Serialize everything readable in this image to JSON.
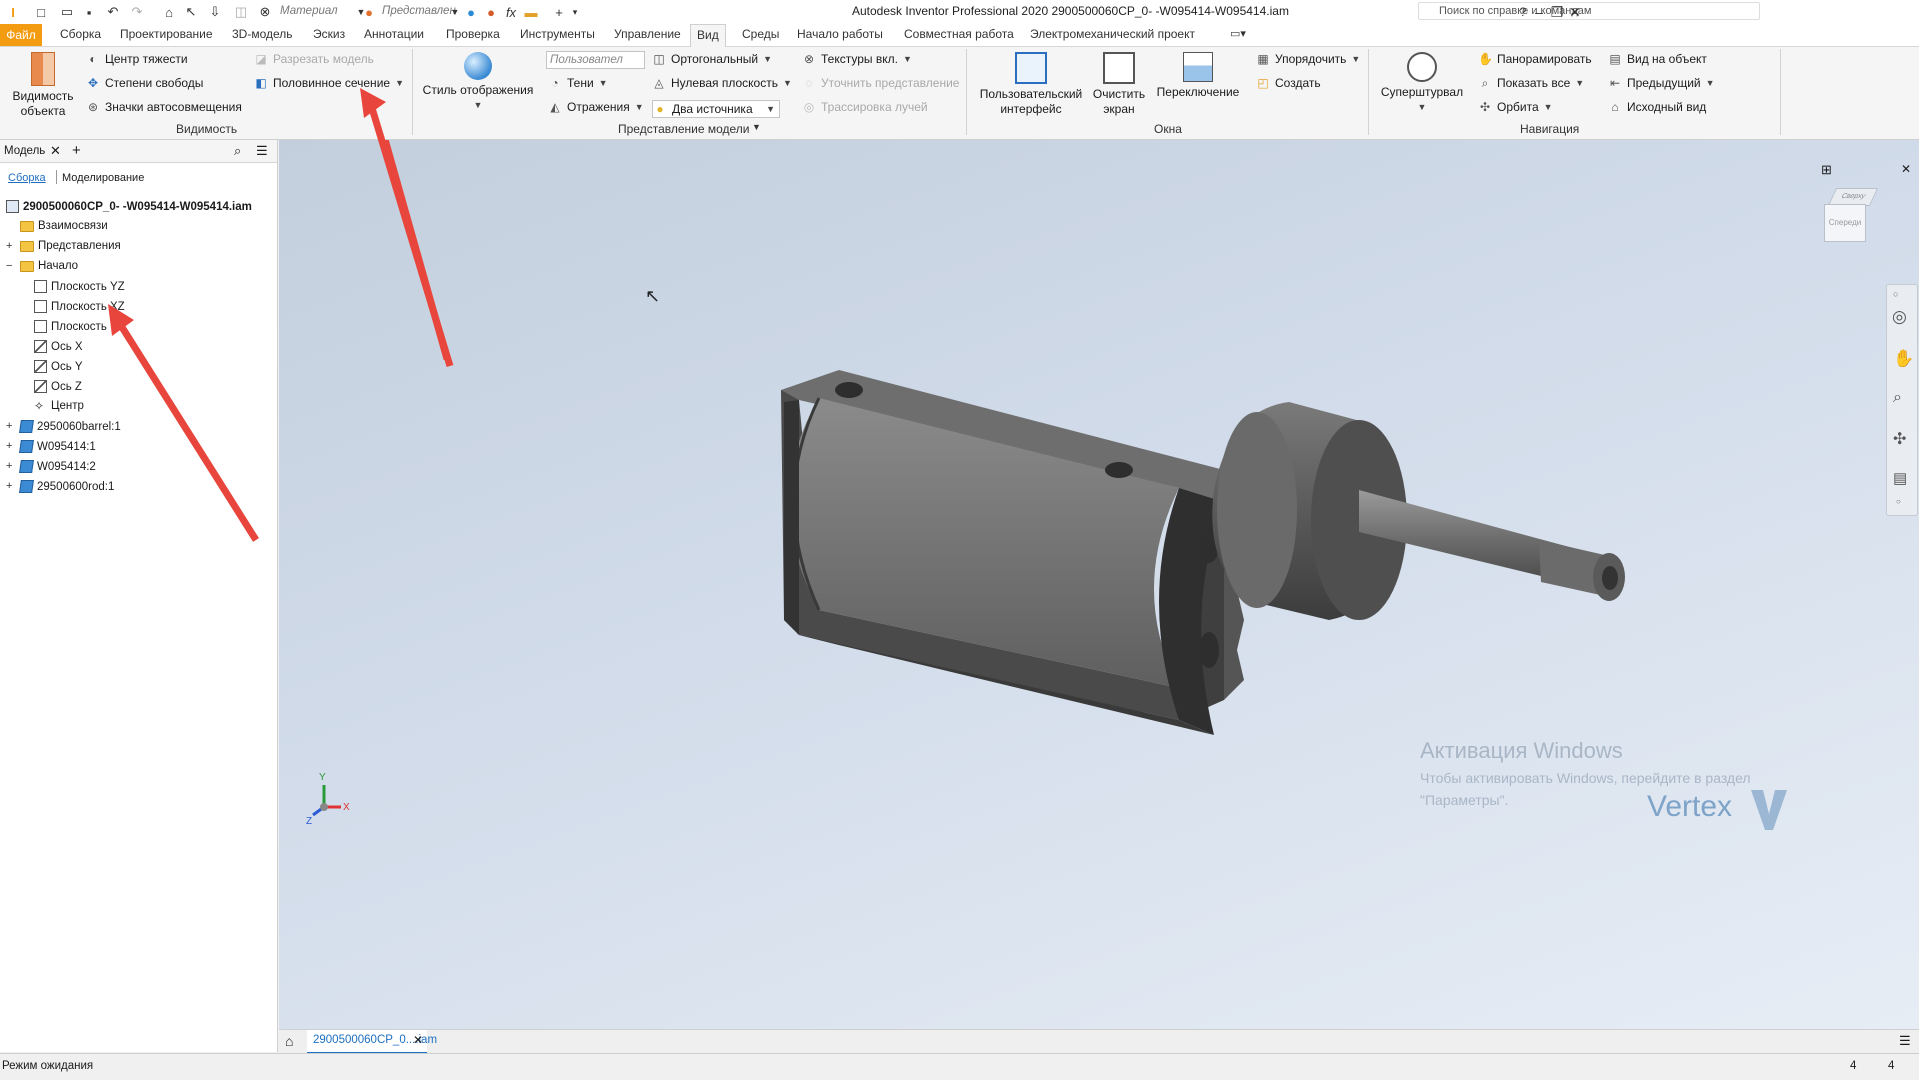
{
  "title": "Autodesk Inventor Professional 2020   2900500060CP_0- -W095414-W095414.iam",
  "quick_access": {
    "material_select": "Материал",
    "appearance_select": "Представлен"
  },
  "search": {
    "placeholder": "Поиск по справке и командам",
    "login": "Вход в службы"
  },
  "tabs": [
    "Сборка",
    "Проектирование",
    "3D-модель",
    "Эскиз",
    "Аннотации",
    "Проверка",
    "Инструменты",
    "Управление",
    "Вид",
    "Среды",
    "Начало работы",
    "Совместная работа",
    "Электромеханический проект"
  ],
  "file_tab": "Файл",
  "active_tab": "Вид",
  "ribbon": {
    "visibility": {
      "big": "Видимость\nобъекта",
      "items": [
        "Центр тяжести",
        "Степени свободы",
        "Значки автосовмещения"
      ],
      "cut_model": "Разрезать модель",
      "half_section": "Половинное сечение",
      "label": "Видимость"
    },
    "appearance": {
      "style_big": "Стиль отображения",
      "user_select": "Пользовател",
      "shadows": "Тени",
      "reflections": "Отражения",
      "ortho": "Ортогональный",
      "ground_plane": "Нулевая плоскость",
      "two_lights": "Два источника",
      "textures": "Текстуры вкл.",
      "refine": "Уточнить представление",
      "raytrace": "Трассировка лучей",
      "label": "Представление модели"
    },
    "windows": {
      "user_interface": "Пользовательский\nинтерфейс",
      "clean_screen": "Очистить\nэкран",
      "switch": "Переключение",
      "arrange": "Упорядочить",
      "create": "Создать",
      "label": "Окна"
    },
    "navigation": {
      "steering": "Суперштурвал",
      "pan": "Панорамировать",
      "zoom_all": "Показать все",
      "orbit": "Орбита",
      "look_at": "Вид на объект",
      "previous": "Предыдущий",
      "home": "Исходный вид",
      "label": "Навигация"
    }
  },
  "panel": {
    "tab_label": "Модель",
    "subtab_assembly": "Сборка",
    "subtab_modeling": "Моделирование",
    "root": "2900500060CP_0- -W095414-W095414.iam",
    "items": [
      {
        "label": "Взаимосвязи",
        "icon": "folder",
        "level": 1,
        "expand": ""
      },
      {
        "label": "Представления",
        "icon": "folder",
        "level": 1,
        "expand": "+"
      },
      {
        "label": "Начало",
        "icon": "folder",
        "level": 1,
        "expand": "−"
      },
      {
        "label": "Плоскость YZ",
        "icon": "plane",
        "level": 2,
        "expand": ""
      },
      {
        "label": "Плоскость XZ",
        "icon": "plane",
        "level": 2,
        "expand": ""
      },
      {
        "label": "Плоскость",
        "icon": "plane",
        "level": 2,
        "expand": ""
      },
      {
        "label": "Ось X",
        "icon": "axis",
        "level": 2,
        "expand": ""
      },
      {
        "label": "Ось Y",
        "icon": "axis",
        "level": 2,
        "expand": ""
      },
      {
        "label": "Ось Z",
        "icon": "axis",
        "level": 2,
        "expand": ""
      },
      {
        "label": "Центр",
        "icon": "point",
        "level": 2,
        "expand": ""
      },
      {
        "label": "2950060barrel:1",
        "icon": "part",
        "level": 1,
        "expand": "+"
      },
      {
        "label": "W095414:1",
        "icon": "part",
        "level": 1,
        "expand": "+"
      },
      {
        "label": "W095414:2",
        "icon": "part",
        "level": 1,
        "expand": "+"
      },
      {
        "label": "29500600rod:1",
        "icon": "part",
        "level": 1,
        "expand": "+"
      }
    ]
  },
  "viewcube": {
    "top": "Сверху",
    "front": "Спереди"
  },
  "watermark": {
    "title": "Активация Windows",
    "text": "Чтобы активировать Windows, перейдите в раздел \"Параметры\".",
    "logo": "Vertex"
  },
  "doc_tab": "2900500060CP_0....iam",
  "status": {
    "text": "Режим ожидания",
    "count1": "4",
    "count2": "4"
  },
  "colors": {
    "file_tab": "#f39c12",
    "arrow": "#e8463c",
    "accent": "#1e6fbf"
  }
}
